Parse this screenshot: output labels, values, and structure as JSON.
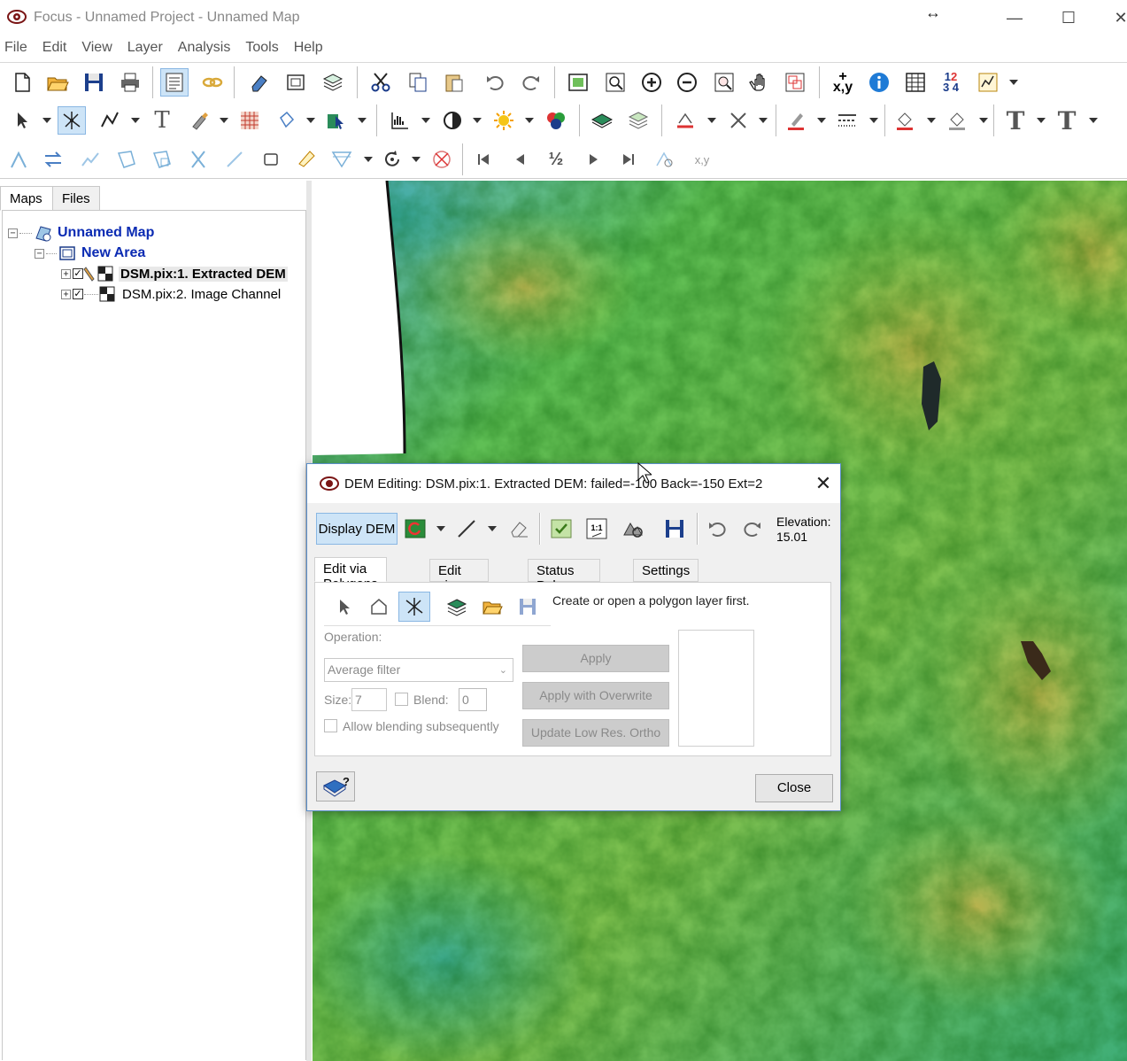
{
  "window": {
    "title": "Focus - Unnamed Project - Unnamed Map",
    "minimize": "—",
    "maximize": "☐",
    "close": "✕",
    "resize_glyph": "↔"
  },
  "menu": [
    "File",
    "Edit",
    "View",
    "Layer",
    "Analysis",
    "Tools",
    "Help"
  ],
  "toolbar3": {
    "half_label": "½",
    "xy_label": "x,y"
  },
  "toolbar1": {
    "xy_label": "x,y"
  },
  "left_panel": {
    "tabs": [
      "Maps",
      "Files"
    ],
    "tree": {
      "map": "Unnamed Map",
      "area": "New Area",
      "layers": [
        "DSM.pix:1. Extracted DEM",
        "DSM.pix:2. Image Channel"
      ]
    }
  },
  "dialog": {
    "title": "DEM Editing: DSM.pix:1. Extracted DEM: failed=-100 Back=-150 Ext=2",
    "display_dem": "Display DEM",
    "elevation_label": "Elevation:",
    "elevation_value": "15.01",
    "tabs": [
      "Edit via Polygons",
      "Edit via Bitmap",
      "Status Polygons",
      "Settings"
    ],
    "hint": "Create or open a polygon layer first.",
    "operation_label": "Operation:",
    "operation_value": "Average filter",
    "size_label": "Size:",
    "size_value": "7",
    "blend_label": "Blend:",
    "blend_value": "0",
    "allow_blending": "Allow blending subsequently",
    "apply": "Apply",
    "apply_overwrite": "Apply with Overwrite",
    "update_ortho": "Update Low Res. Ortho",
    "close": "Close"
  },
  "colors": {
    "accent": "#cde4f7",
    "tree_link": "#0b2bb3",
    "dem_low": "#2c9fd0",
    "dem_mid": "#5fbf45",
    "dem_high": "#c9b24a"
  },
  "icons": {
    "app": "eye-icon",
    "toolbar1": [
      "new-file-icon",
      "open-folder-icon",
      "save-icon",
      "print-icon",
      "properties-icon",
      "link-icon",
      "eraser-icon",
      "frame-icon",
      "layers-icon",
      "cut-icon",
      "copy-icon",
      "paste-icon",
      "undo-icon",
      "redo-icon",
      "zoom-extent-icon",
      "zoom-window-icon",
      "zoom-in-icon",
      "zoom-out-icon",
      "zoom-layer-icon",
      "pan-icon",
      "overview-icon",
      "coordinates-icon",
      "info-icon",
      "table-icon",
      "numbers-icon",
      "chart-icon"
    ],
    "toolbar2": [
      "select-arrow-icon",
      "edit-vertex-icon",
      "polyline-icon",
      "text-icon",
      "brush-icon",
      "grid-icon",
      "fill-icon",
      "export-icon",
      "histogram-icon",
      "contrast-icon",
      "brightness-icon",
      "rgb-icon",
      "layer-stack-icon",
      "layer-stack2-icon",
      "vertex-add-icon",
      "vertex-remove-icon",
      "pen-color-icon",
      "line-style-icon",
      "fill-color-icon",
      "fill-color2-icon",
      "text-style-icon",
      "text-style2-icon"
    ],
    "toolbar3": [
      "move-vertex-icon",
      "swap-icon",
      "split-line-icon",
      "reshape-icon",
      "reshape2-icon",
      "scissors-icon",
      "line-tool-icon",
      "rectangle-icon",
      "lasso-icon",
      "filter-icon",
      "rotate-icon",
      "delete-shape-icon",
      "first-icon",
      "prev-icon",
      "half-icon",
      "next-icon",
      "last-icon",
      "snap-icon",
      "xy-tool-icon"
    ]
  }
}
